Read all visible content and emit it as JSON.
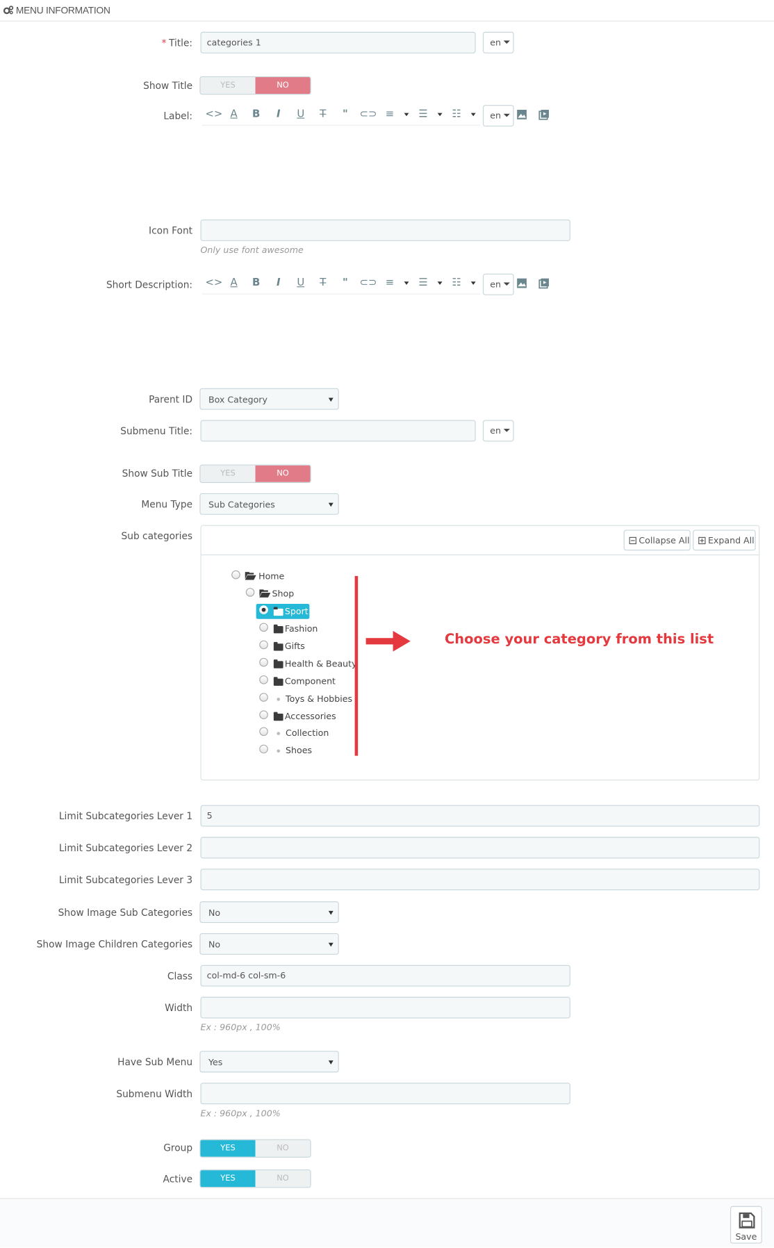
{
  "header": {
    "title": "MENU INFORMATION",
    "icon": "cogs-icon"
  },
  "form": {
    "title": {
      "label": "Title:",
      "required_mark": "*",
      "value": "categories 1",
      "lang": "en"
    },
    "show_title": {
      "label": "Show Title",
      "yes": "YES",
      "no": "NO",
      "selected": "NO"
    },
    "label_field": {
      "label": "Label:",
      "lang": "en"
    },
    "icon_font": {
      "label": "Icon Font",
      "value": "",
      "hint": "Only use font awesome"
    },
    "short_description": {
      "label": "Short Description:",
      "lang": "en"
    },
    "parent_id": {
      "label": "Parent ID",
      "selected": "Box Category"
    },
    "submenu_title": {
      "label": "Submenu Title:",
      "value": "",
      "lang": "en"
    },
    "show_sub_title": {
      "label": "Show Sub Title",
      "yes": "YES",
      "no": "NO",
      "selected": "NO"
    },
    "menu_type": {
      "label": "Menu Type",
      "selected": "Sub Categories"
    },
    "sub_categories": {
      "label": "Sub categories",
      "collapse_all": "Collapse All",
      "expand_all": "Expand All",
      "tree": [
        {
          "label": "Home",
          "type": "folder-open",
          "selected": false
        },
        {
          "label": "Shop",
          "type": "folder-open",
          "selected": false
        },
        {
          "label": "Sport",
          "type": "folder",
          "selected": true
        },
        {
          "label": "Fashion",
          "type": "folder",
          "selected": false
        },
        {
          "label": "Gifts",
          "type": "folder",
          "selected": false
        },
        {
          "label": "Health & Beauty",
          "type": "folder",
          "selected": false
        },
        {
          "label": "Component",
          "type": "folder",
          "selected": false
        },
        {
          "label": "Toys & Hobbies",
          "type": "leaf",
          "selected": false
        },
        {
          "label": "Accessories",
          "type": "folder",
          "selected": false
        },
        {
          "label": "Collection",
          "type": "leaf",
          "selected": false
        },
        {
          "label": "Shoes",
          "type": "leaf",
          "selected": false
        }
      ],
      "annotation": "Choose your category from this list"
    },
    "limit_lever_1": {
      "label": "Limit Subcategories Lever 1",
      "value": "5"
    },
    "limit_lever_2": {
      "label": "Limit Subcategories Lever 2",
      "value": ""
    },
    "limit_lever_3": {
      "label": "Limit Subcategories Lever 3",
      "value": ""
    },
    "show_image_sub": {
      "label": "Show Image Sub Categories",
      "selected": "No"
    },
    "show_image_children": {
      "label": "Show Image Children Categories",
      "selected": "No"
    },
    "class_field": {
      "label": "Class",
      "value": "col-md-6 col-sm-6"
    },
    "width": {
      "label": "Width",
      "value": "",
      "hint": "Ex : 960px , 100%"
    },
    "have_sub_menu": {
      "label": "Have Sub Menu",
      "selected": "Yes"
    },
    "submenu_width": {
      "label": "Submenu Width",
      "value": "",
      "hint": "Ex : 960px , 100%"
    },
    "group": {
      "label": "Group",
      "yes": "YES",
      "no": "NO",
      "selected": "YES"
    },
    "active": {
      "label": "Active",
      "yes": "YES",
      "no": "NO",
      "selected": "YES"
    }
  },
  "footer": {
    "save_label": "Save"
  },
  "colors": {
    "accent": "#25b9d7",
    "toggle_no": "#e07b87",
    "annotation": "#e3393f"
  }
}
